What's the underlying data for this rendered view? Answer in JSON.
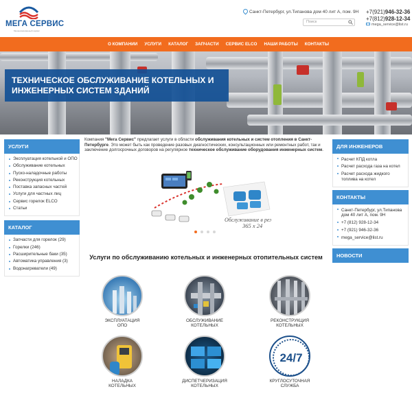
{
  "header": {
    "logo_text": "МЕГА СЕРВИС",
    "logo_sub": "Механизированный сервис",
    "address": "Санкт-Петербург, ул.Типанова дом 40 лит А, пом. 9Н",
    "search_placeholder": "Поиск",
    "phone1_prefix": "+7(921)",
    "phone1_num": "946-32-36",
    "phone2_prefix": "+7(812)",
    "phone2_num": "928-12-34",
    "email": "mega_service@list.ru"
  },
  "nav": {
    "items": [
      "О компании",
      "Услуги",
      "Каталог",
      "Запчасти",
      "Сервис ELCO",
      "Наши работы",
      "Контакты"
    ]
  },
  "banner": {
    "title": "Техническое обслуживание котельных и инженерных систем зданий"
  },
  "sidebar_left": {
    "services_title": "Услуги",
    "services": [
      "Эксплуатация котельной и ОПО",
      "Обслуживание котельных",
      "Пуско-наладочные работы",
      "Реконструкция котельных",
      "Поставка запасных частей",
      "Услуги для частных лиц",
      "Сервис горелок ELCO",
      "Статьи"
    ],
    "catalog_title": "Каталог",
    "catalog": [
      "Запчасти для горелок (29)",
      "Горелки (246)",
      "Расширительные баки (35)",
      "Автоматика управления (3)",
      "Водонагреватели (49)"
    ]
  },
  "sidebar_right": {
    "engineers_title": "Для инженеров",
    "engineers": [
      "Расчет КПД котла",
      "Расчет расхода газа на котел",
      "Расчет расхода жидкого топлива на котел"
    ],
    "contacts_title": "Контакты",
    "contacts": [
      "Санкт-Петербург, ул.Типанова дом 40 лит А, пом. 9Н",
      "+7 (812) 928-12-34",
      "+7 (921) 946-32-36",
      "mega_service@list.ru"
    ],
    "news_title": "Новости"
  },
  "intro": {
    "p1": "Компания ",
    "p2": "\"Мега Сервис\"",
    "p3": " предлагает услуги в области ",
    "p4": "обслуживания котельных и систем отопления в Санкт-Петербурге",
    "p5": ". Это может быть как проведение разовых диагностических, консультационных или ремонтных работ, так и заключение долгосрочных договоров на регулярное ",
    "p6": "техническое обслуживание оборудования инженерных систем",
    "p7": "."
  },
  "illustration": {
    "caption_line1": "Обслуживание в режиме",
    "caption_line2": "365 x 24"
  },
  "slider": {
    "active_index": 0,
    "count": 4
  },
  "services": {
    "title": "Услуги по обслуживанию котельных и инженерных отопительных систем",
    "items": [
      {
        "line1": "Эксплуатация",
        "line2": "ОПО"
      },
      {
        "line1": "Обслуживание",
        "line2": "котельных"
      },
      {
        "line1": "Реконструкция",
        "line2": "котельных"
      },
      {
        "line1": "Наладка",
        "line2": "котельных"
      },
      {
        "line1": "Диспетчеризация",
        "line2": "котельных"
      },
      {
        "line1": "Круглосуточная",
        "line2": "служба"
      }
    ],
    "badge_247": "24/7"
  },
  "colors": {
    "accent": "#f26c1e",
    "brand_blue": "#1a5aa0",
    "box_title": "#3f8fd2"
  }
}
